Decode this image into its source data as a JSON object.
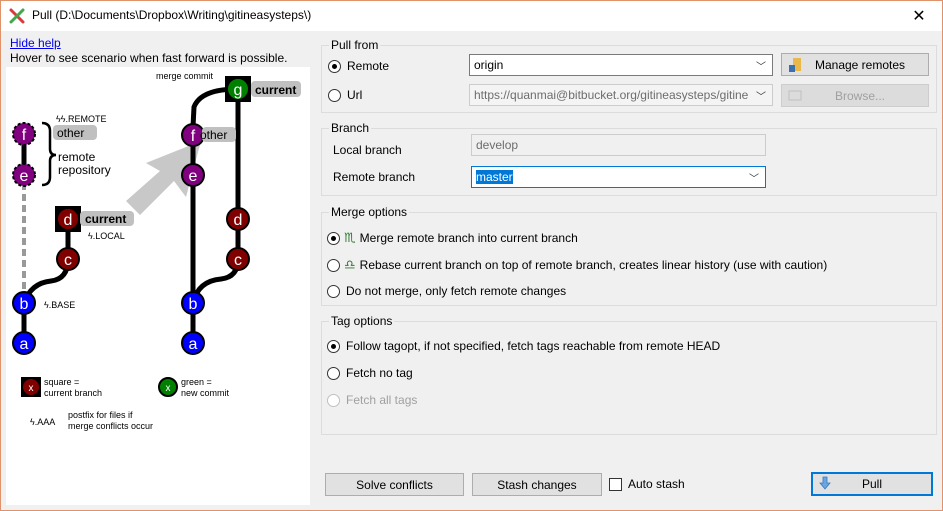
{
  "window": {
    "title": "Pull (D:\\Documents\\Dropbox\\Writing\\gitineasysteps\\)",
    "close_glyph": "✕"
  },
  "help": {
    "link_label": "Hide help",
    "hint": "Hover to see scenario when fast forward is possible."
  },
  "diagram": {
    "left_graph": {
      "commits": [
        {
          "id": "f",
          "color": "purple",
          "style": "dashed"
        },
        {
          "id": "e",
          "color": "purple",
          "style": "dashed"
        },
        {
          "id": "d",
          "color": "darkred",
          "style": "square-current"
        },
        {
          "id": "c",
          "color": "darkred",
          "style": "solid"
        },
        {
          "id": "b",
          "color": "blue",
          "style": "solid"
        },
        {
          "id": "a",
          "color": "blue",
          "style": "solid"
        }
      ],
      "remote_postfix": "ϟ.REMOTE",
      "other_tag": "other",
      "remote_repo_label_1": "remote",
      "remote_repo_label_2": "repository",
      "current_tag": "current",
      "local_postfix": ".LOCAL",
      "base_postfix": ".BASE"
    },
    "right_graph": {
      "merge_commit_label": "merge commit",
      "commits": [
        {
          "id": "g",
          "color": "green",
          "style": "square-current"
        },
        {
          "id": "f",
          "color": "purple",
          "style": "solid"
        },
        {
          "id": "e",
          "color": "purple",
          "style": "solid"
        },
        {
          "id": "d",
          "color": "darkred",
          "style": "solid"
        },
        {
          "id": "c",
          "color": "darkred",
          "style": "solid"
        },
        {
          "id": "b",
          "color": "blue",
          "style": "solid"
        },
        {
          "id": "a",
          "color": "blue",
          "style": "solid"
        }
      ],
      "current_tag": "current",
      "other_tag": "other"
    },
    "legend": {
      "square_marker": "x",
      "square_line1": "square =",
      "square_line2": "current branch",
      "green_marker": "x",
      "green_line1": "green =",
      "green_line2": "new commit",
      "postfix_sample": ".AAA",
      "postfix_line1": "postfix for files if",
      "postfix_line2": "merge conflicts occur"
    },
    "colors": {
      "blue": "#0000ff",
      "darkred": "#800000",
      "purple": "#800080",
      "green": "#008000",
      "tag_bg": "#c0c0c0"
    }
  },
  "pull_from": {
    "title": "Pull from",
    "remote_label": "Remote",
    "remote_checked": true,
    "remote_value": "origin",
    "url_label": "Url",
    "url_checked": false,
    "url_value": "https://quanmai@bitbucket.org/gitineasysteps/gitine",
    "manage_remotes_label": "Manage remotes",
    "browse_label": "Browse..."
  },
  "branch": {
    "title": "Branch",
    "local_label": "Local branch",
    "local_value": "develop",
    "remote_label": "Remote branch",
    "remote_value": "master"
  },
  "merge_options": {
    "title": "Merge options",
    "options": [
      {
        "label": "Merge remote branch into current branch",
        "icon": "♏",
        "checked": true
      },
      {
        "label": "Rebase current branch on top of remote branch, creates linear history (use with caution)",
        "icon": "♎",
        "checked": false
      },
      {
        "label": "Do not merge, only fetch remote changes",
        "icon": "",
        "checked": false
      }
    ]
  },
  "tag_options": {
    "title": "Tag options",
    "options": [
      {
        "label": "Follow tagopt, if not specified, fetch tags reachable from remote HEAD",
        "checked": true,
        "disabled": false
      },
      {
        "label": "Fetch no tag",
        "checked": false,
        "disabled": false
      },
      {
        "label": "Fetch all tags",
        "checked": false,
        "disabled": true
      }
    ]
  },
  "footer": {
    "solve_conflicts_label": "Solve conflicts",
    "stash_changes_label": "Stash changes",
    "auto_stash_label": "Auto stash",
    "auto_stash_checked": false,
    "pull_label": "Pull"
  }
}
